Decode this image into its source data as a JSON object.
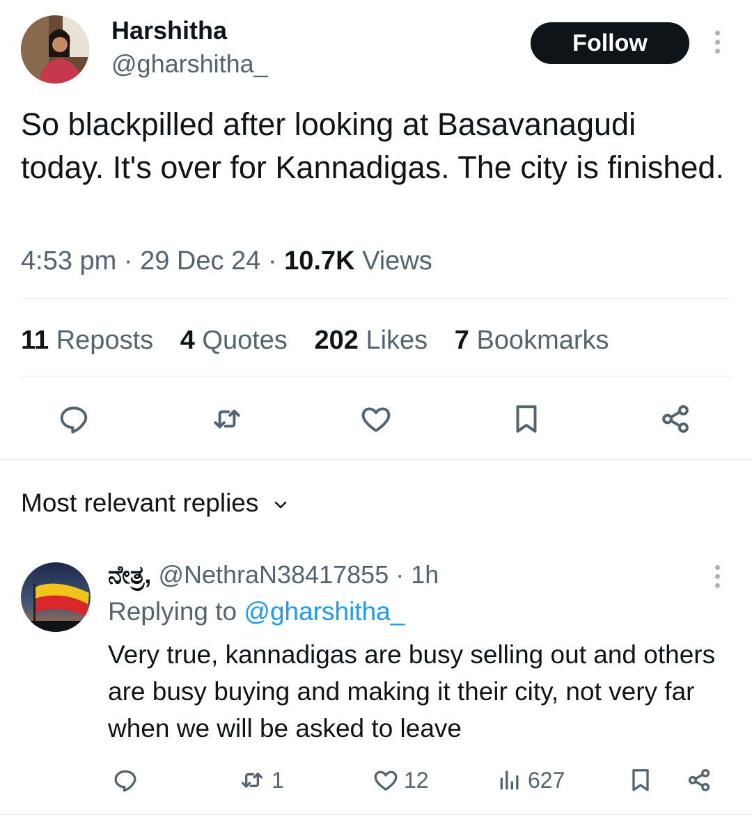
{
  "tweet": {
    "author_name": "Harshitha",
    "author_handle": "@gharshitha_",
    "follow_label": "Follow",
    "text": "So blackpilled after looking at Basavanagudi today. It's over for Kannadigas. The city is finished.",
    "time": "4:53 pm",
    "date": "29 Dec 24",
    "views_count": "10.7K",
    "views_label": "Views",
    "separator": "·"
  },
  "stats": [
    {
      "count": "11",
      "label": "Reposts"
    },
    {
      "count": "4",
      "label": "Quotes"
    },
    {
      "count": "202",
      "label": "Likes"
    },
    {
      "count": "7",
      "label": "Bookmarks"
    }
  ],
  "actions": [
    "reply-icon",
    "repost-icon",
    "like-icon",
    "bookmark-icon",
    "share-icon"
  ],
  "replies_sort": {
    "label": "Most relevant replies"
  },
  "reply": {
    "author_name": "ನೇತ್ರ",
    "author_handle": "@NethraN38417855",
    "separator": "·",
    "time": "1h",
    "replying_prefix": "Replying to",
    "replying_handle": "@gharshitha_",
    "text": "Very true, kannadigas are busy selling out and others are busy buying and making it their city, not very far when we will be asked to leave",
    "reposts": "1",
    "likes": "12",
    "views": "627"
  },
  "colors": {
    "text_primary": "#0f1419",
    "text_secondary": "#536471",
    "link": "#1d9bf0",
    "divider": "#e6e9eb"
  }
}
